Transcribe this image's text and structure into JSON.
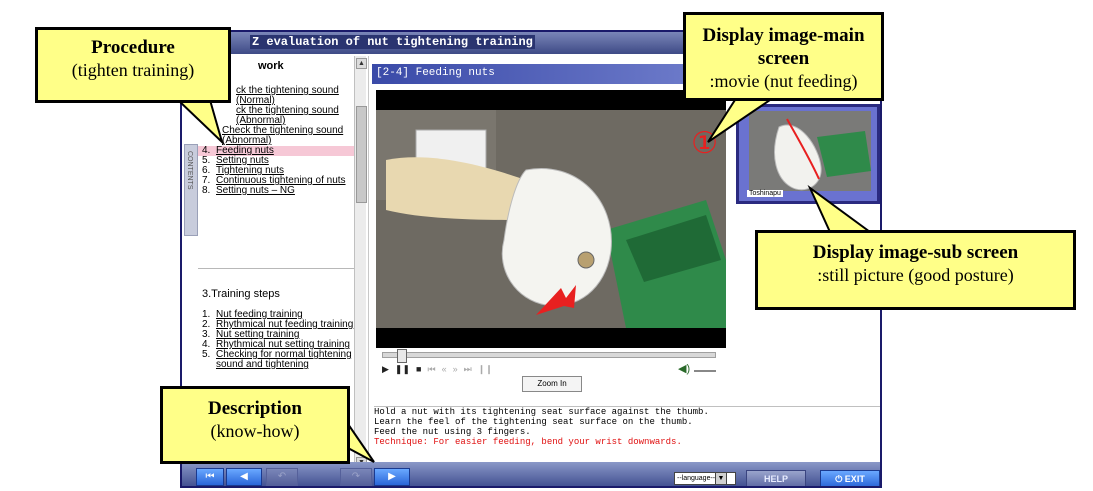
{
  "app": {
    "window_title": "Z evaluation of nut tightening training",
    "left_tab_label": "CONTENTS",
    "sections": {
      "work": {
        "heading": "work",
        "items": [
          {
            "num": "",
            "label": "ck the tightening sound (Normal)"
          },
          {
            "num": "",
            "label": "ck the tightening sound (Abnormal)"
          },
          {
            "num": "",
            "label": "Check the tightening sound (Abnormal)"
          },
          {
            "num": "4.",
            "label": "Feeding nuts",
            "selected": true
          },
          {
            "num": "5.",
            "label": "Setting nuts"
          },
          {
            "num": "6.",
            "label": "Tightening nuts"
          },
          {
            "num": "7.",
            "label": "Continuous tightening of nuts"
          },
          {
            "num": "8.",
            "label": "Setting nuts – NG"
          }
        ]
      },
      "training": {
        "heading": "3.Training steps",
        "items": [
          {
            "num": "1.",
            "label": "Nut feeding training"
          },
          {
            "num": "2.",
            "label": "Rhythmical nut feeding training"
          },
          {
            "num": "3.",
            "label": "Nut setting training"
          },
          {
            "num": "4.",
            "label": "Rhythmical nut setting training"
          },
          {
            "num": "5.",
            "label": "Checking for normal tightening sound and tightening"
          }
        ]
      }
    },
    "main_header": "[2-4] Feeding nuts",
    "video_number": "①",
    "sub_caption": "Toshinapu",
    "player": {
      "play": "▶",
      "pause": "❚❚",
      "stop": "■",
      "skip_first": "⏮",
      "rewind": "«",
      "forward": "»",
      "skip_last": "⏭",
      "frame": "❙❙",
      "volume_icon": "◀)",
      "zoom_label": "Zoom In"
    },
    "description": {
      "lines": [
        "Hold a nut with its tightening seat surface against the thumb.",
        "Learn the feel of the tightening seat surface on the thumb.",
        "Feed the nut using 3 fingers."
      ],
      "technique": "Technique: For easier feeding, bend your wrist downwards."
    },
    "bottom_bar": {
      "first_button": "⏮",
      "prev_button": "◀",
      "prev2_button": "↶",
      "next2_button": "↷",
      "next_button": "▶",
      "language": "--language--",
      "language_arrow": "▼",
      "help": "HELP",
      "exit": "⏻ EXIT"
    }
  },
  "callouts": {
    "procedure": {
      "head": "Procedure",
      "sub": "(tighten training)"
    },
    "main_screen": {
      "head": "Display image-main screen",
      "sub": ":movie (nut feeding)"
    },
    "sub_screen": {
      "head": "Display image-sub screen",
      "sub": ":still picture (good posture)"
    },
    "description": {
      "head": "Description",
      "sub": "(know-how)"
    }
  },
  "colors": {
    "callout_fill": "#ffff88",
    "title_bar": "#3e4a86",
    "selected_item": "#f6c8d6",
    "technique_text": "#e01010",
    "arrow": "#e82020"
  }
}
